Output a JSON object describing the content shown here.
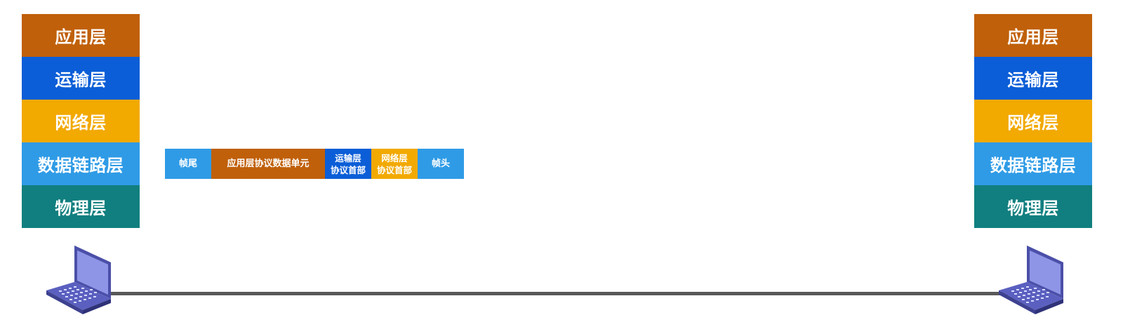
{
  "colors": {
    "application": "#c0600a",
    "transport": "#0b5ed7",
    "network": "#f2a900",
    "datalink": "#2f9be6",
    "physical": "#117f7f",
    "cable": "#595959",
    "laptop_screen": "#8f95e6",
    "laptop_body": "#4b4fa8"
  },
  "left_stack": {
    "layers": [
      "应用层",
      "运输层",
      "网络层",
      "数据链路层",
      "物理层"
    ]
  },
  "right_stack": {
    "layers": [
      "应用层",
      "运输层",
      "网络层",
      "数据链路层",
      "物理层"
    ]
  },
  "frame": {
    "segments": [
      {
        "text": "帧尾",
        "role": "frame-trailer"
      },
      {
        "text": "应用层协议数据单元",
        "role": "application-pdu"
      },
      {
        "text": "运输层\n协议首部",
        "role": "transport-header"
      },
      {
        "text": "网络层\n协议首部",
        "role": "network-header"
      },
      {
        "text": "帧头",
        "role": "frame-header"
      }
    ]
  },
  "icons": {
    "left_host": "laptop-icon",
    "right_host": "laptop-icon"
  }
}
